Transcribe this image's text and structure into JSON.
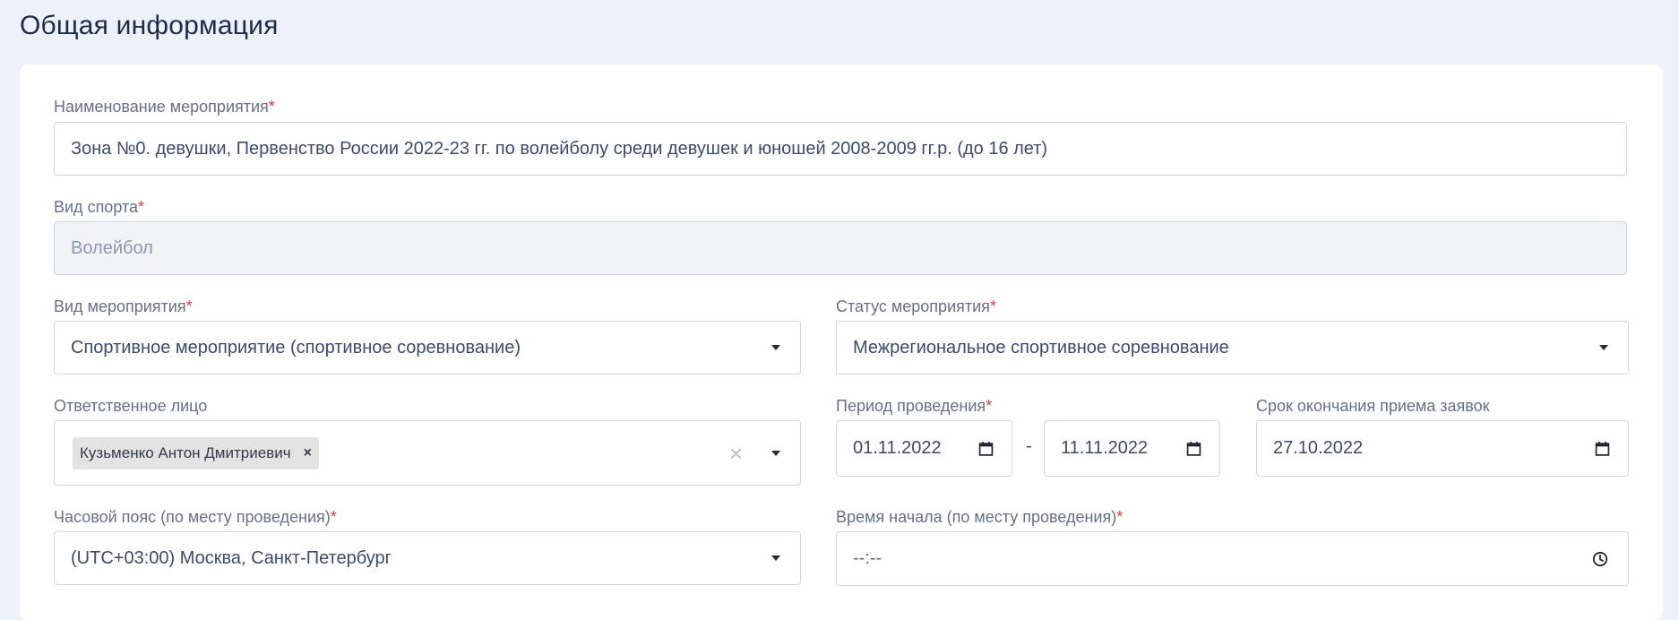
{
  "page": {
    "title": "Общая информация"
  },
  "form": {
    "event_name": {
      "label": "Наименование мероприятия",
      "required_mark": "*",
      "value": "Зона №0. девушки, Первенство России 2022-23 гг. по волейболу среди девушек и юношей 2008-2009 гг.р. (до 16 лет)"
    },
    "sport": {
      "label": "Вид спорта",
      "required_mark": "*",
      "value": "Волейбол",
      "disabled": true
    },
    "event_type": {
      "label": "Вид мероприятия",
      "required_mark": "*",
      "value": "Спортивное мероприятие (спортивное соревнование)"
    },
    "event_status": {
      "label": "Статус мероприятия",
      "required_mark": "*",
      "value": "Межрегиональное спортивное соревнование"
    },
    "responsible": {
      "label": "Ответственное лицо",
      "chip": "Кузьменко Антон Дмитриевич",
      "chip_remove": "×",
      "clear": "×"
    },
    "period": {
      "label": "Период проведения",
      "required_mark": "*",
      "start": "01.11.2022",
      "separator": "-",
      "end": "11.11.2022"
    },
    "deadline": {
      "label": "Срок окончания приема заявок",
      "value": "27.10.2022"
    },
    "timezone": {
      "label": "Часовой пояс (по месту проведения)",
      "required_mark": "*",
      "value": "(UTC+03:00) Москва, Санкт-Петербург"
    },
    "start_time": {
      "label": "Время начала (по месту проведения)",
      "required_mark": "*",
      "value": "--:--"
    }
  },
  "colors": {
    "background": "#edf1fa",
    "card": "#ffffff",
    "required": "#e53935",
    "label": "#66708a",
    "text": "#3c4a6e"
  }
}
